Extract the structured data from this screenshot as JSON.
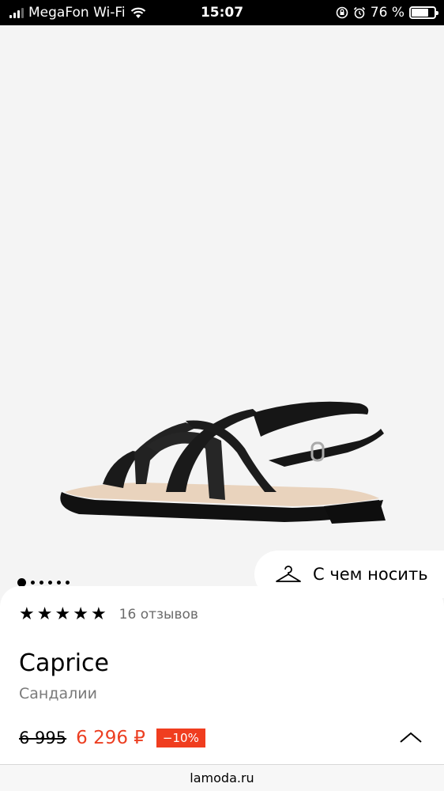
{
  "status_bar": {
    "carrier": "MegaFon Wi-Fi",
    "time": "15:07",
    "battery": "76 %",
    "battery_level": 0.76,
    "icons": [
      "signal-icon",
      "wifi-icon",
      "orientation-lock-icon",
      "alarm-icon",
      "battery-icon"
    ]
  },
  "gallery": {
    "image": "sandal-photo",
    "total_slides": 6,
    "active_slide": 1
  },
  "wear_with": {
    "label": "С чем носить",
    "icon": "hanger-icon"
  },
  "product": {
    "rating": 5,
    "rating_max": 5,
    "reviews": "16 отзывов",
    "brand": "Caprice",
    "category": "Сандалии",
    "old_price": "6 995",
    "new_price": "6 296 ₽",
    "discount": "−10%"
  },
  "browser": {
    "url": "lamoda.ru"
  },
  "colors": {
    "accent_red": "#ec3f22",
    "discount_bg": "#f03d1f",
    "background": "#f4f4f4"
  }
}
